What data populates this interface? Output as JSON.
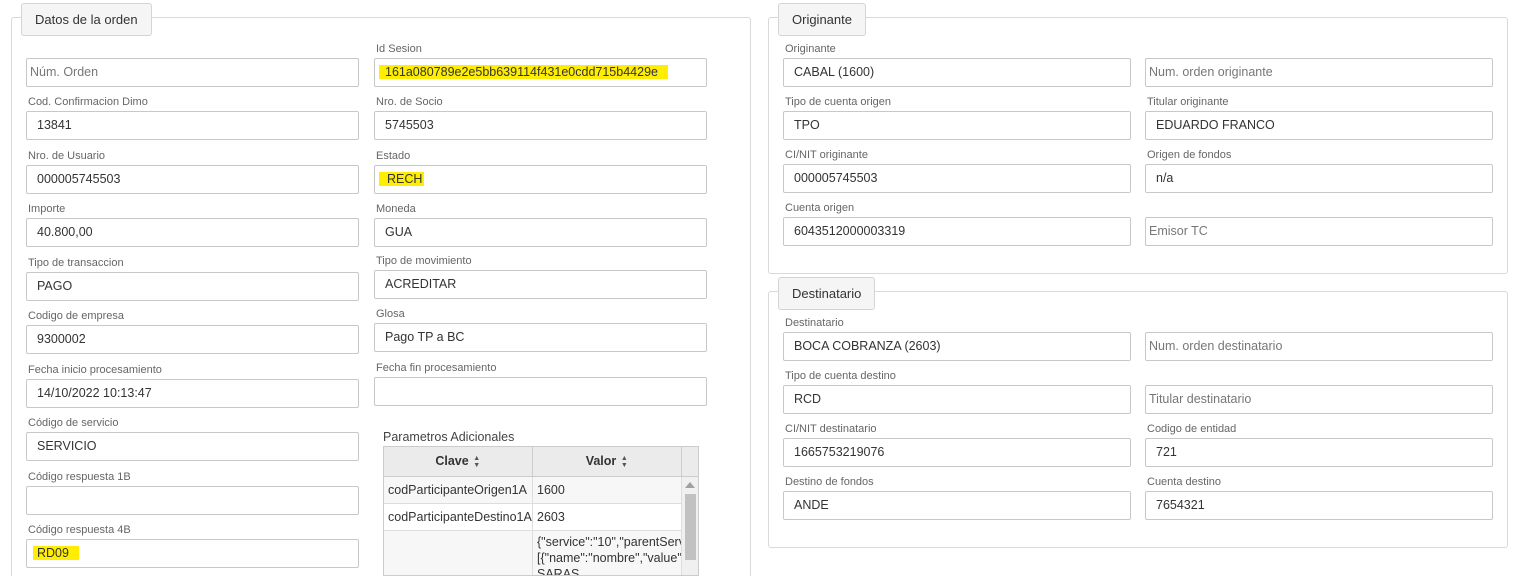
{
  "orden": {
    "legend": "Datos de la orden",
    "num_orden": {
      "placeholder": "Núm. Orden"
    },
    "id_sesion": {
      "label": "Id Sesion",
      "value": "161a080789e2e5bb639114f431e0cdd715b4429e"
    },
    "cod_confirmacion": {
      "label": "Cod. Confirmacion Dimo",
      "value": "13841"
    },
    "nro_socio": {
      "label": "Nro. de Socio",
      "value": "5745503"
    },
    "nro_usuario": {
      "label": "Nro. de Usuario",
      "value": "000005745503"
    },
    "estado": {
      "label": "Estado",
      "value": "RECH"
    },
    "importe": {
      "label": "Importe",
      "value": "40.800,00"
    },
    "moneda": {
      "label": "Moneda",
      "value": "GUA"
    },
    "tipo_transaccion": {
      "label": "Tipo de transaccion",
      "value": "PAGO"
    },
    "tipo_movimiento": {
      "label": "Tipo de movimiento",
      "value": "ACREDITAR"
    },
    "codigo_empresa": {
      "label": "Codigo de empresa",
      "value": "9300002"
    },
    "glosa": {
      "label": "Glosa",
      "value": "Pago TP a BC"
    },
    "fecha_inicio": {
      "label": "Fecha inicio procesamiento",
      "value": "14/10/2022 10:13:47"
    },
    "fecha_fin": {
      "label": "Fecha fin procesamiento",
      "value": ""
    },
    "codigo_servicio": {
      "label": "Código de servicio",
      "value": "SERVICIO"
    },
    "codigo_resp_1b": {
      "label": "Código respuesta 1B",
      "value": ""
    },
    "codigo_resp_4b": {
      "label": "Código respuesta 4B",
      "value": "RD09"
    }
  },
  "parametros": {
    "caption": "Parametros Adicionales",
    "col_clave": "Clave",
    "col_valor": "Valor",
    "rows": [
      {
        "clave": "codParticipanteOrigen1A",
        "valor": "1600"
      },
      {
        "clave": "codParticipanteDestino1A",
        "valor": "2603"
      },
      {
        "clave": "",
        "valor": "{\"service\":\"10\",\"parentServ"
      }
    ],
    "valor_extra_1": "[{\"name\":\"nombre\",\"value\"",
    "valor_extra_2": "SARAS"
  },
  "originante": {
    "legend": "Originante",
    "originante": {
      "label": "Originante",
      "value": "CABAL (1600)"
    },
    "num_orden_originante": {
      "placeholder": "Num. orden originante"
    },
    "tipo_cuenta_origen": {
      "label": "Tipo de cuenta origen",
      "value": "TPO"
    },
    "titular_originante": {
      "label": "Titular originante",
      "value": "EDUARDO FRANCO"
    },
    "ci_nit_originante": {
      "label": "CI/NIT originante",
      "value": "000005745503"
    },
    "origen_fondos": {
      "label": "Origen de fondos",
      "value": "n/a"
    },
    "cuenta_origen": {
      "label": "Cuenta origen",
      "value": "6043512000003319"
    },
    "emisor_tc": {
      "placeholder": "Emisor TC"
    }
  },
  "destinatario": {
    "legend": "Destinatario",
    "destinatario": {
      "label": "Destinatario",
      "value": "BOCA COBRANZA (2603)"
    },
    "num_orden_destinatario": {
      "placeholder": "Num. orden destinatario"
    },
    "tipo_cuenta_destino": {
      "label": "Tipo de cuenta destino",
      "value": "RCD"
    },
    "titular_destinatario": {
      "placeholder": "Titular destinatario"
    },
    "ci_nit_destinatario": {
      "label": "CI/NIT destinatario",
      "value": "1665753219076"
    },
    "codigo_entidad": {
      "label": "Codigo de entidad",
      "value": "721"
    },
    "destino_fondos": {
      "label": "Destino de fondos",
      "value": "ANDE"
    },
    "cuenta_destino": {
      "label": "Cuenta destino",
      "value": "7654321"
    }
  },
  "colors": {
    "highlight": "#ffee00",
    "border": "#c8c8c8"
  }
}
